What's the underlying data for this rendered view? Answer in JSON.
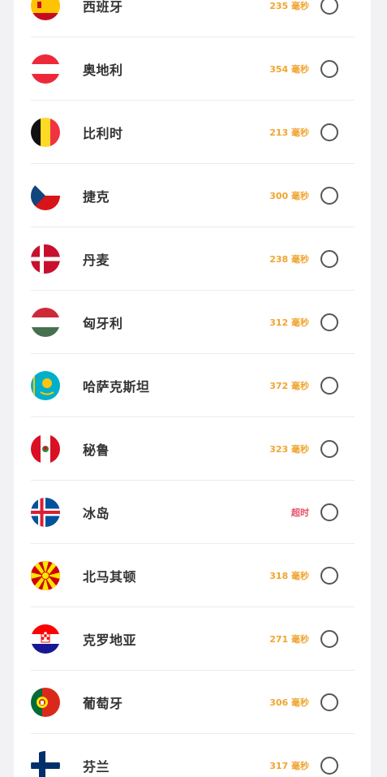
{
  "servers": [
    {
      "name": "西班牙",
      "latency": "235 毫秒",
      "flag_icon": "spain-flag-icon",
      "timeout": false
    },
    {
      "name": "奥地利",
      "latency": "354 毫秒",
      "flag_icon": "austria-flag-icon",
      "timeout": false
    },
    {
      "name": "比利时",
      "latency": "213 毫秒",
      "flag_icon": "belgium-flag-icon",
      "timeout": false
    },
    {
      "name": "捷克",
      "latency": "300 毫秒",
      "flag_icon": "czech-flag-icon",
      "timeout": false
    },
    {
      "name": "丹麦",
      "latency": "238 毫秒",
      "flag_icon": "denmark-flag-icon",
      "timeout": false
    },
    {
      "name": "匈牙利",
      "latency": "312 毫秒",
      "flag_icon": "hungary-flag-icon",
      "timeout": false
    },
    {
      "name": "哈萨克斯坦",
      "latency": "372 毫秒",
      "flag_icon": "kazakhstan-flag-icon",
      "timeout": false
    },
    {
      "name": "秘鲁",
      "latency": "323 毫秒",
      "flag_icon": "peru-flag-icon",
      "timeout": false
    },
    {
      "name": "冰岛",
      "latency": "超时",
      "flag_icon": "iceland-flag-icon",
      "timeout": true
    },
    {
      "name": "北马其顿",
      "latency": "318 毫秒",
      "flag_icon": "north-macedonia-flag-icon",
      "timeout": false
    },
    {
      "name": "克罗地亚",
      "latency": "271 毫秒",
      "flag_icon": "croatia-flag-icon",
      "timeout": false
    },
    {
      "name": "葡萄牙",
      "latency": "306 毫秒",
      "flag_icon": "portugal-flag-icon",
      "timeout": false
    },
    {
      "name": "芬兰",
      "latency": "317 毫秒",
      "flag_icon": "finland-flag-icon",
      "timeout": false
    }
  ],
  "colors": {
    "latency_ok": "#f0a531",
    "latency_timeout": "#e4506a"
  }
}
